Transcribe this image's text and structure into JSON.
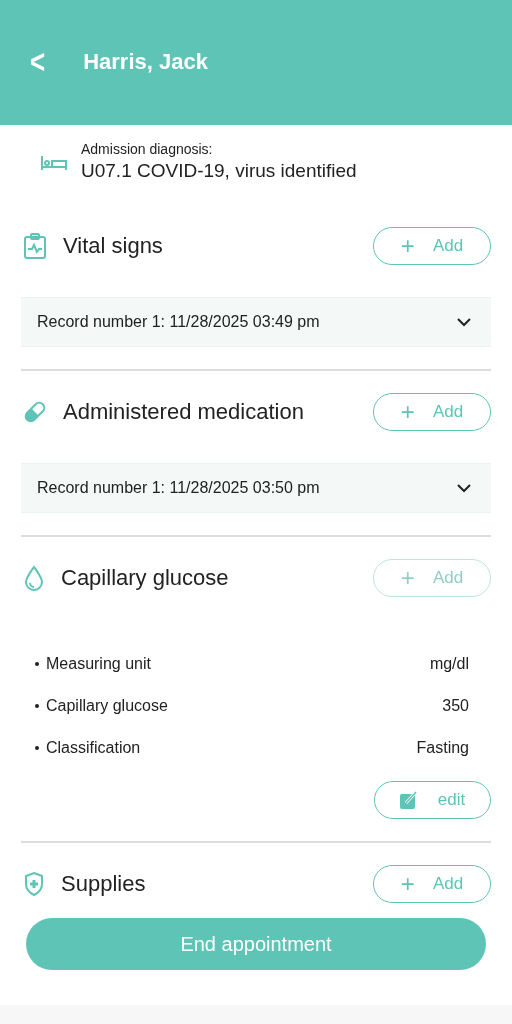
{
  "header": {
    "back": "<",
    "title": "Harris, Jack"
  },
  "diagnosis": {
    "label": "Admission diagnosis:",
    "value": "U07.1 COVID-19, virus identified"
  },
  "sections": [
    {
      "kind": "records",
      "title": "Vital signs",
      "add": {
        "plus": "+",
        "label": "Add",
        "disabled": false
      },
      "records": [
        {
          "label": "Record number 1: 11/28/2025 03:49 pm",
          "expanded": false
        }
      ]
    },
    {
      "kind": "records",
      "title": "Administered medication",
      "add": {
        "plus": "+",
        "label": "Add",
        "disabled": false
      },
      "records": [
        {
          "label": "Record number 1: 11/28/2025 03:50 pm",
          "expanded": false
        }
      ]
    },
    {
      "kind": "details",
      "title": "Capillary glucose",
      "add": {
        "plus": "+",
        "label": "Add",
        "disabled": true
      },
      "details": [
        {
          "label": "Measuring unit",
          "value": "mg/dl"
        },
        {
          "label": "Capillary glucose",
          "value": "350"
        },
        {
          "label": "Classification",
          "value": "Fasting"
        }
      ],
      "edit": "edit"
    },
    {
      "kind": "records",
      "title": "Supplies",
      "add": {
        "plus": "+",
        "label": "Add",
        "disabled": false
      }
    }
  ],
  "end_button": "End appointment"
}
